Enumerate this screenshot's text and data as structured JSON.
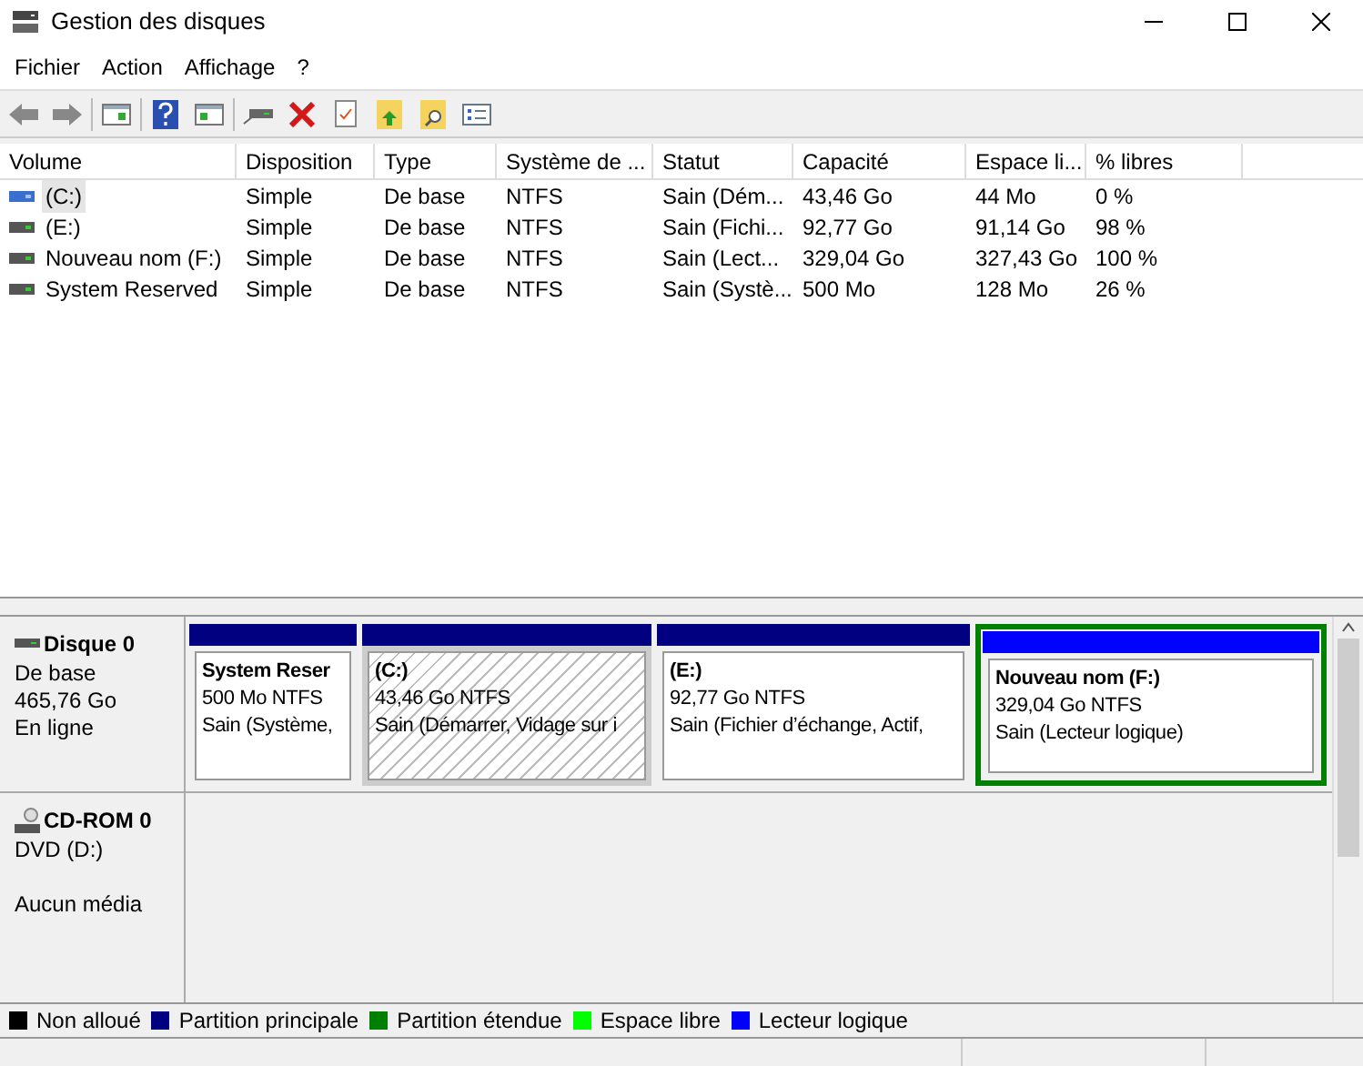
{
  "window": {
    "title": "Gestion des disques"
  },
  "menu": [
    "Fichier",
    "Action",
    "Affichage",
    "?"
  ],
  "table": {
    "columns": [
      "Volume",
      "Disposition",
      "Type",
      "Système de ...",
      "Statut",
      "Capacité",
      "Espace li...",
      "% libres"
    ],
    "rows": [
      {
        "selected": true,
        "cells": [
          "(C:)",
          "Simple",
          "De base",
          "NTFS",
          "Sain (Dém...",
          "43,46 Go",
          "44 Mo",
          "0 %"
        ]
      },
      {
        "selected": false,
        "cells": [
          "(E:)",
          "Simple",
          "De base",
          "NTFS",
          "Sain (Fichi...",
          "92,77 Go",
          "91,14 Go",
          "98 %"
        ]
      },
      {
        "selected": false,
        "cells": [
          "Nouveau nom (F:)",
          "Simple",
          "De base",
          "NTFS",
          "Sain (Lect...",
          "329,04 Go",
          "327,43 Go",
          "100 %"
        ]
      },
      {
        "selected": false,
        "cells": [
          "System Reserved",
          "Simple",
          "De base",
          "NTFS",
          "Sain (Systè...",
          "500 Mo",
          "128 Mo",
          "26 %"
        ]
      }
    ]
  },
  "disks": [
    {
      "kind": "disk",
      "name": "Disque 0",
      "lines": [
        "De base",
        "465,76 Go",
        "En ligne"
      ],
      "partitions": [
        {
          "kind": "primary",
          "selected": false,
          "extended": false,
          "name": "System Reser",
          "size": "500 Mo NTFS",
          "status": "Sain (Système,"
        },
        {
          "kind": "primary",
          "selected": true,
          "extended": false,
          "name": "(C:)",
          "size": "43,46 Go NTFS",
          "status": "Sain (Démarrer, Vidage sur i"
        },
        {
          "kind": "primary",
          "selected": false,
          "extended": false,
          "name": "(E:)",
          "size": "92,77 Go NTFS",
          "status": "Sain (Fichier d’échange, Actif,"
        },
        {
          "kind": "logical",
          "selected": false,
          "extended": true,
          "name": "Nouveau nom  (F:)",
          "size": "329,04 Go NTFS",
          "status": "Sain (Lecteur logique)"
        }
      ]
    },
    {
      "kind": "cdrom",
      "name": "CD-ROM 0",
      "lines": [
        "DVD (D:)",
        "Aucun média"
      ]
    }
  ],
  "legend": [
    {
      "label": "Non alloué",
      "color": "#000000"
    },
    {
      "label": "Partition principale",
      "color": "#000080"
    },
    {
      "label": "Partition étendue",
      "color": "#008000"
    },
    {
      "label": "Espace libre",
      "color": "#00ff00"
    },
    {
      "label": "Lecteur logique",
      "color": "#0000ff"
    }
  ]
}
